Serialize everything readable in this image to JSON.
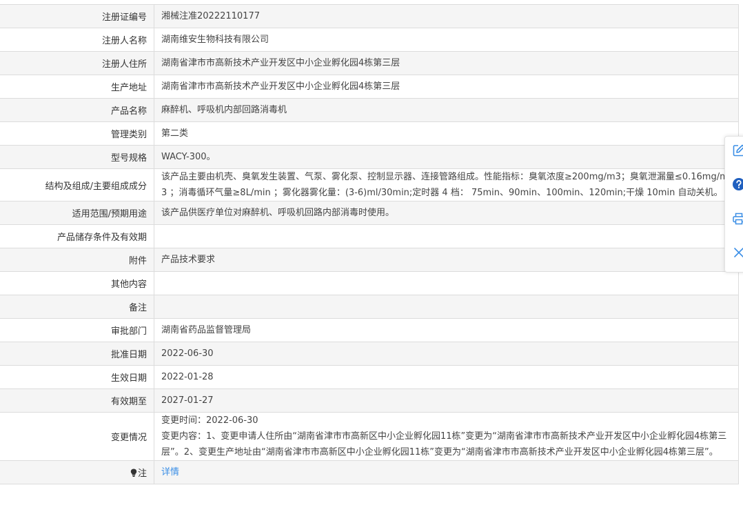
{
  "rows": [
    {
      "label": "注册证编号",
      "value": "湘械注准20222110177"
    },
    {
      "label": "注册人名称",
      "value": "湖南维安生物科技有限公司"
    },
    {
      "label": "注册人住所",
      "value": "湖南省津市市高新技术产业开发区中小企业孵化园4栋第三层"
    },
    {
      "label": "生产地址",
      "value": "湖南省津市市高新技术产业开发区中小企业孵化园4栋第三层"
    },
    {
      "label": "产品名称",
      "value": "麻醉机、呼吸机内部回路消毒机"
    },
    {
      "label": "管理类别",
      "value": "第二类"
    },
    {
      "label": "型号规格",
      "value": "WACY-300。"
    },
    {
      "label": "结构及组成/主要组成成分",
      "value": "该产品主要由机壳、臭氧发生装置、气泵、雾化泵、控制显示器、连接管路组成。性能指标：臭氧浓度≥200mg/m3；臭氧泄漏量≤0.16mg/m3 ；消毒循环气量≥8L/min ；雾化器雾化量：(3-6)ml/30min;定时器 4 档： 75min、90min、100min、120min;干燥 10min 自动关机。"
    },
    {
      "label": "适用范围/预期用途",
      "value": "该产品供医疗单位对麻醉机、呼吸机回路内部消毒时使用。"
    },
    {
      "label": "产品储存条件及有效期",
      "value": ""
    },
    {
      "label": "附件",
      "value": "产品技术要求"
    },
    {
      "label": "其他内容",
      "value": ""
    },
    {
      "label": "备注",
      "value": ""
    },
    {
      "label": "审批部门",
      "value": "湖南省药品监督管理局"
    },
    {
      "label": "批准日期",
      "value": "2022-06-30"
    },
    {
      "label": "生效日期",
      "value": "2022-01-28"
    },
    {
      "label": "有效期至",
      "value": "2027-01-27"
    }
  ],
  "change": {
    "label": "变更情况",
    "time_line": "变更时间：2022-06-30",
    "content_line": "变更内容：1、变更申请人住所由“湖南省津市市高新区中小企业孵化园11栋”变更为“湖南省津市市高新技术产业开发区中小企业孵化园4栋第三层”。2、变更生产地址由“湖南省津市市高新区中小企业孵化园11栋”变更为“湖南省津市市高新技术产业开发区中小企业孵化园4栋第三层”。"
  },
  "note": {
    "label": "注",
    "link": "详情"
  },
  "float_bar": {
    "icons": [
      "edit-icon",
      "help-icon",
      "print-icon",
      "close-icon"
    ],
    "accent": "#3a8ee6"
  }
}
